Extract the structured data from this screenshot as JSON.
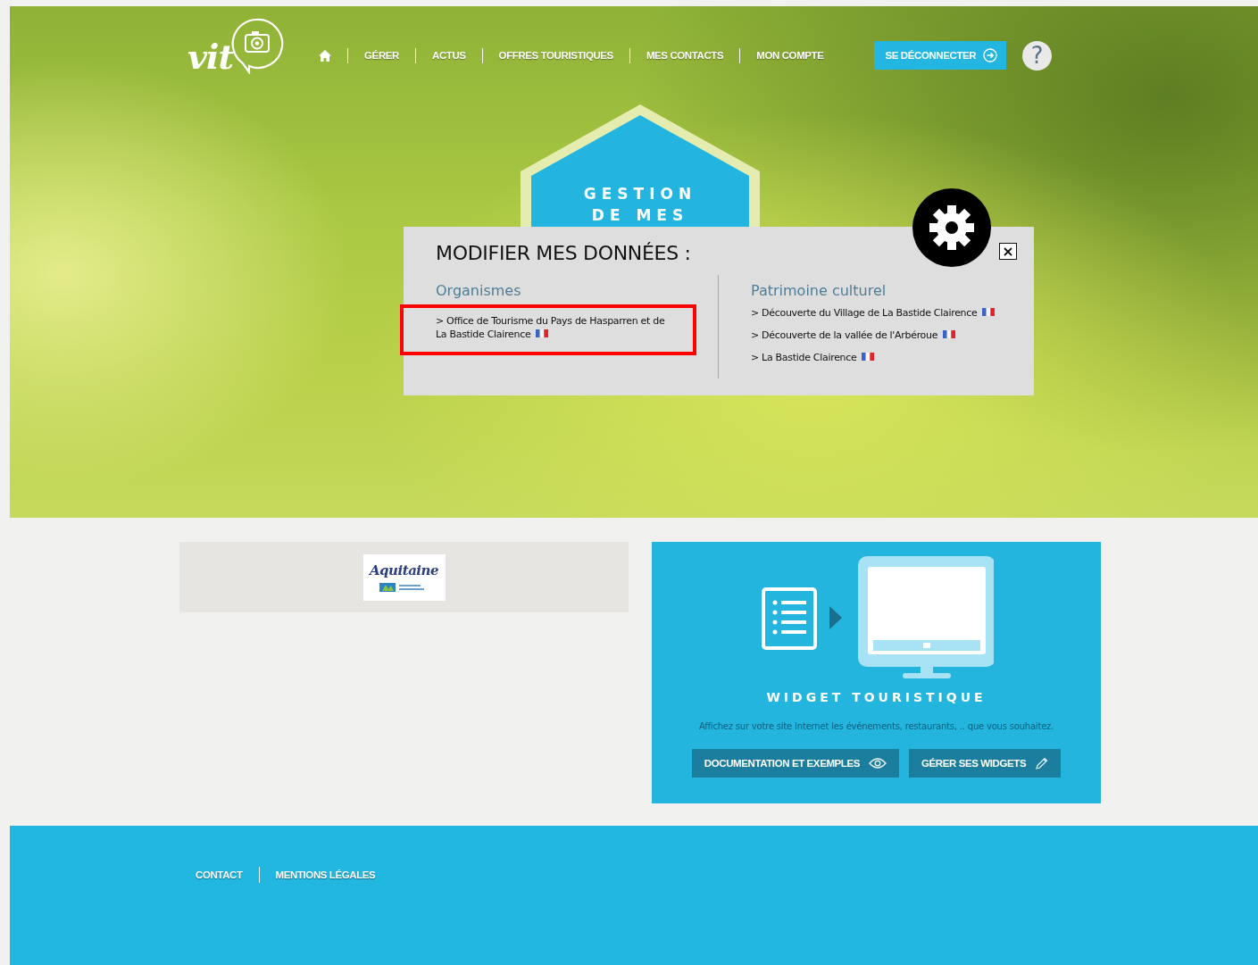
{
  "header": {
    "logo": "vit",
    "nav": [
      {
        "kind": "home"
      },
      {
        "kind": "link",
        "label": "GÉRER"
      },
      {
        "kind": "link",
        "label": "ACTUS"
      },
      {
        "kind": "link",
        "label": "OFFRES TOURISTIQUES"
      },
      {
        "kind": "link",
        "label": "MES CONTACTS"
      },
      {
        "kind": "link",
        "label": "MON COMPTE"
      }
    ],
    "logout_button": "SE DÉCONNECTER",
    "help_button": "?"
  },
  "hero": {
    "title_lines": [
      "GESTION",
      "DE MES"
    ]
  },
  "modal": {
    "title": "MODIFIER MES DONNÉES :",
    "columns": [
      {
        "heading": "Organismes",
        "items": [
          {
            "label": "> Office de Tourisme du Pays de Hasparren et de La Bastide Clairence",
            "highlighted": true
          }
        ]
      },
      {
        "heading": "Patrimoine culturel",
        "items": [
          {
            "label": "> Découverte du Village de La Bastide Clairence",
            "highlighted": false
          },
          {
            "label": "> Découverte de la vallée de l'Arbéroue",
            "highlighted": false
          },
          {
            "label": "> La Bastide Clairence",
            "highlighted": false
          }
        ]
      }
    ]
  },
  "partner_logo": {
    "text": "Aquitaine"
  },
  "widget": {
    "title": "WIDGET TOURISTIQUE",
    "description": "Affichez sur votre site Internet les événements, restaurants, .. que vous souhaitez.",
    "buttons": [
      {
        "kind": "view",
        "label": "DOCUMENTATION ET EXEMPLES"
      },
      {
        "kind": "edit",
        "label": "GÉRER SES WIDGETS"
      }
    ]
  },
  "footer": {
    "links": [
      "CONTACT",
      "MENTIONS LÉGALES"
    ]
  }
}
